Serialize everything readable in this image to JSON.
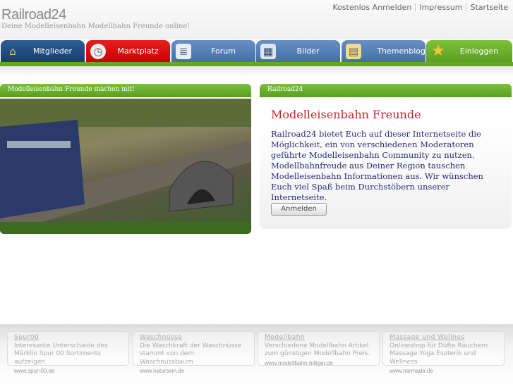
{
  "header": {
    "logo": "Railroad24",
    "slogan": "Deine Modelleisenbahn Modellbahn Freunde online!",
    "links": [
      "Kostenlos Anmelden",
      "Impressum",
      "Startseite"
    ]
  },
  "tabs": [
    {
      "label": "Mitglieder",
      "icon": "house-icon",
      "color": "#1e4a80"
    },
    {
      "label": "Marktplatz",
      "icon": "clock-icon",
      "color": "#cc1111"
    },
    {
      "label": "Forum",
      "icon": "document-icon",
      "color": "#4d7bb5"
    },
    {
      "label": "Bilder",
      "icon": "image-grid-icon",
      "color": "#4d7bb5"
    },
    {
      "label": "Themenblog",
      "icon": "clipboard-icon",
      "color": "#4d7bb5"
    },
    {
      "label": "Einloggen",
      "icon": "star-icon",
      "color": "#67a629"
    }
  ],
  "left_panel": {
    "title": "Modelleisenbahn Freunde machen mit!"
  },
  "right_panel": {
    "title": "Railroad24",
    "heading": "Modelleisenbahn Freunde",
    "text": "Railroad24 bietet Euch auf dieser Internetseite die Möglichkeit, ein von verschiedenen Moderatoren geführte Modelleisenbahn Community zu nutzen. Modellbahnfreude aus Deiner Region tauschen Modelleisenbahn Informationen aus. Wir wünschen Euch viel Spaß beim Durchstöbern unserer Internetseite.",
    "button": "Anmelden"
  },
  "ads": [
    {
      "title": "Spur00",
      "text": "Interesante Unterschiede des Märklin Spur 00 Sortiments aufzeigen.",
      "url": "www.spur-00.de"
    },
    {
      "title": "Waschnüsse",
      "text": "Die Waschkraft der Waschnüsse stammt von dem Waschnussbaum",
      "url": "www.natursein.de"
    },
    {
      "title": "Modellbahn",
      "text": "Verschiedene Modellbahn Artikel zum günstigen Modellbahn Preis.",
      "url": "www.modellbahn-billiger.de"
    },
    {
      "title": "Massage und Wellnes",
      "text": "Onlineshop für Düfte Räuchern Massage Yoga Esoterik und Wellness",
      "url": "www.narmada.de"
    }
  ]
}
